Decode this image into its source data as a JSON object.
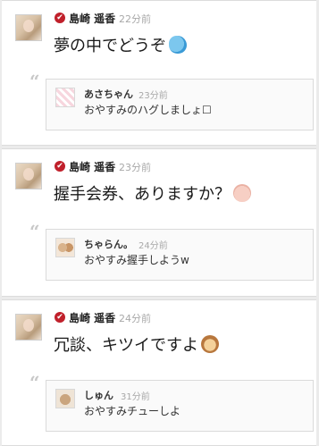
{
  "posts": [
    {
      "author": "島崎 遥香",
      "time": "22分前",
      "text": "夢の中でどうぞ",
      "emoji": "fish-emoji",
      "reply": {
        "author": "あさちゃん",
        "time": "23分前",
        "text": "おやすみのハグしましょ☐"
      }
    },
    {
      "author": "島崎 遥香",
      "time": "23分前",
      "text": "握手会券、ありますか？",
      "emoji": "raised-hand-emoji",
      "reply": {
        "author": "ちゃらん。",
        "time": "24分前",
        "text": "おやすみ握手しようw"
      }
    },
    {
      "author": "島崎 遥香",
      "time": "24分前",
      "text": "冗談、キツイですよ",
      "emoji": "monkey-face-emoji",
      "reply": {
        "author": "しゅん",
        "time": "31分前",
        "text": "おやすみチューしよ"
      }
    }
  ],
  "icons": {
    "verified": "✔",
    "quote": "“"
  },
  "colors": {
    "verified_badge": "#c0202b",
    "timestamp": "#a8a8a8",
    "background": "#ebebeb"
  }
}
